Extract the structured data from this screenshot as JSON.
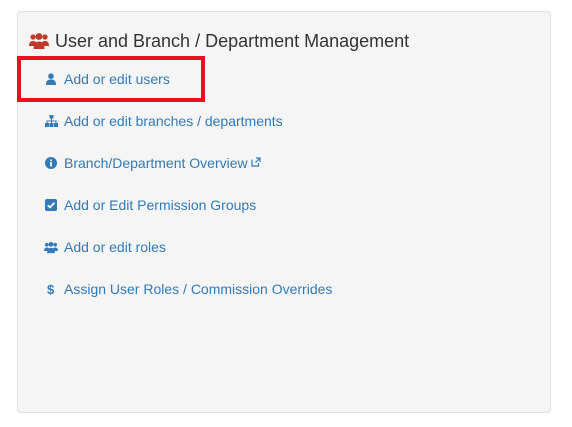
{
  "panel": {
    "title": "User and Branch / Department Management",
    "header_icon": "users-icon",
    "header_icon_color": "#c0392b",
    "link_color": "#337ab7",
    "highlight_color": "#e8131f"
  },
  "menu": {
    "items": [
      {
        "label": "Add or edit users",
        "icon": "user-icon"
      },
      {
        "label": "Add or edit branches / departments",
        "icon": "sitemap-icon"
      },
      {
        "label": "Branch/Department Overview",
        "icon": "info-circle-icon",
        "external": true
      },
      {
        "label": "Add or Edit Permission Groups",
        "icon": "check-square-icon"
      },
      {
        "label": "Add or edit roles",
        "icon": "users-icon"
      },
      {
        "label": "Assign User Roles / Commission Overrides",
        "icon": "dollar-icon"
      }
    ]
  }
}
